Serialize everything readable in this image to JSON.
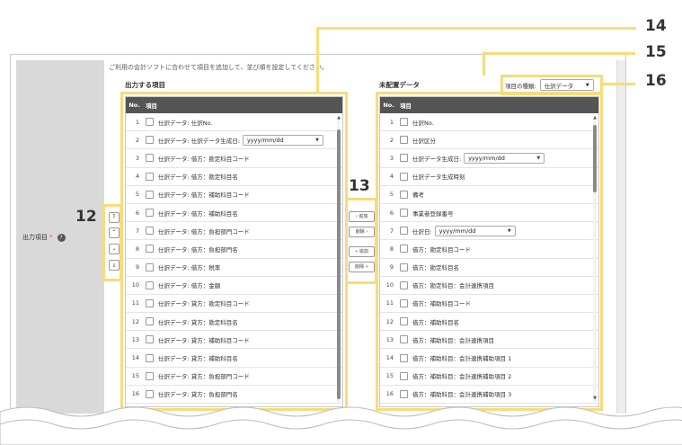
{
  "intro_text": "ご利用の会計ソフトに合わせて項目を追加して、並び順を設定してください。",
  "field_label": "出力項目",
  "required_mark": "*",
  "help_icon": "?",
  "output_panel": {
    "title": "出力する項目",
    "col_no": "No.",
    "col_item": "項目",
    "rows": [
      {
        "no": "1",
        "label": "仕訳データ: 仕訳No.",
        "date": ""
      },
      {
        "no": "2",
        "label": "仕訳データ: 仕訳データ生成日:",
        "date": "yyyy/mm/dd"
      },
      {
        "no": "3",
        "label": "仕訳データ: 借方：勘定科目コード",
        "date": ""
      },
      {
        "no": "4",
        "label": "仕訳データ: 借方：勘定科目名",
        "date": ""
      },
      {
        "no": "5",
        "label": "仕訳データ: 借方：補助科目コード",
        "date": ""
      },
      {
        "no": "6",
        "label": "仕訳データ: 借方：補助科目名",
        "date": ""
      },
      {
        "no": "7",
        "label": "仕訳データ: 借方：負担部門コード",
        "date": ""
      },
      {
        "no": "8",
        "label": "仕訳データ: 借方：負担部門名",
        "date": ""
      },
      {
        "no": "9",
        "label": "仕訳データ: 借方：税率",
        "date": ""
      },
      {
        "no": "10",
        "label": "仕訳データ: 借方：金額",
        "date": ""
      },
      {
        "no": "11",
        "label": "仕訳データ: 貸方：勘定科目コード",
        "date": ""
      },
      {
        "no": "12",
        "label": "仕訳データ: 貸方：勘定科目名",
        "date": ""
      },
      {
        "no": "13",
        "label": "仕訳データ: 貸方：補助科目コード",
        "date": ""
      },
      {
        "no": "14",
        "label": "仕訳データ: 貸方：補助科目名",
        "date": ""
      },
      {
        "no": "15",
        "label": "仕訳データ: 貸方：負担部門コード",
        "date": ""
      },
      {
        "no": "16",
        "label": "仕訳データ: 貸方：負担部門名",
        "date": ""
      }
    ]
  },
  "unassigned_panel": {
    "title": "未配置データ",
    "col_no": "No.",
    "col_item": "項目",
    "rows": [
      {
        "no": "1",
        "label": "仕訳No.",
        "date": ""
      },
      {
        "no": "2",
        "label": "仕訳区分",
        "date": ""
      },
      {
        "no": "3",
        "label": "仕訳データ生成日:",
        "date": "yyyy/mm/dd"
      },
      {
        "no": "4",
        "label": "仕訳データ生成時刻",
        "date": ""
      },
      {
        "no": "5",
        "label": "備考",
        "date": ""
      },
      {
        "no": "6",
        "label": "事業者登録番号",
        "date": ""
      },
      {
        "no": "7",
        "label": "仕訳日:",
        "date": "yyyy/mm/dd"
      },
      {
        "no": "8",
        "label": "借方：勘定科目コード",
        "date": ""
      },
      {
        "no": "9",
        "label": "借方：勘定科目名",
        "date": ""
      },
      {
        "no": "10",
        "label": "借方：勘定科目：会計連携項目",
        "date": ""
      },
      {
        "no": "11",
        "label": "借方：補助科目コード",
        "date": ""
      },
      {
        "no": "12",
        "label": "借方：補助科目名",
        "date": ""
      },
      {
        "no": "13",
        "label": "借方：補助科目：会計連携項目",
        "date": ""
      },
      {
        "no": "14",
        "label": "借方：補助科目：会計連携補助項目 1",
        "date": ""
      },
      {
        "no": "15",
        "label": "借方：補助科目：会計連携補助項目 2",
        "date": ""
      },
      {
        "no": "16",
        "label": "借方：補助科目：会計連携補助項目 3",
        "date": ""
      }
    ]
  },
  "item_type": {
    "label": "項目の種類:",
    "value": "仕訳データ"
  },
  "order_buttons": [
    "⤒",
    "⌃",
    "⌄",
    "⤓"
  ],
  "move_buttons": {
    "add_one": "‹ 追加",
    "remove_one": "削除 ›",
    "add_all": "« 追加",
    "remove_all": "削除 »"
  },
  "callouts": {
    "n12": "12",
    "n13": "13",
    "n14": "14",
    "n15": "15",
    "n16": "16"
  },
  "colors": {
    "highlight": "#f7dc7a",
    "header": "#555555",
    "label_col": "#d9d9d9",
    "required": "#e0447a"
  }
}
